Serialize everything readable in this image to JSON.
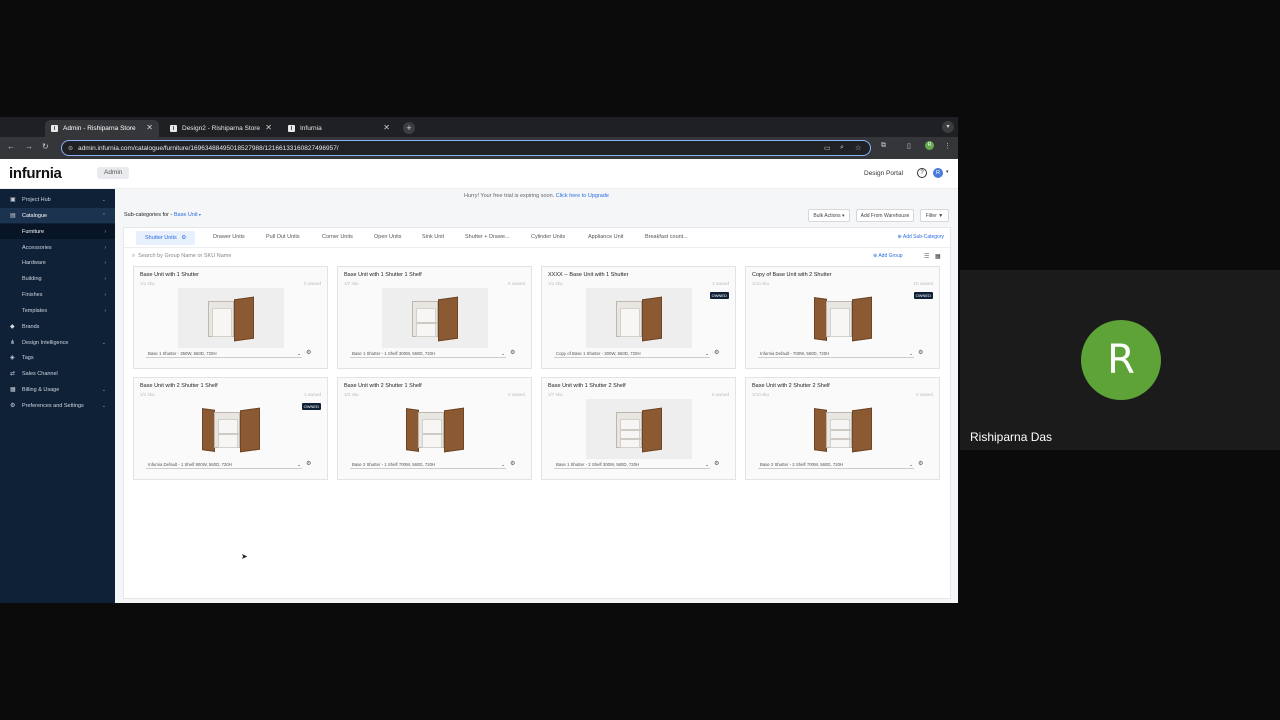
{
  "browser": {
    "tabs": [
      {
        "label": "Admin - Rishiparna Store",
        "active": true
      },
      {
        "label": "Design2 - Rishiparna Store",
        "active": false
      },
      {
        "label": "Infurnia",
        "active": false
      }
    ],
    "url": "admin.infurnia.com/catalogue/furniture/16963488495018527988/12166133160827496957/"
  },
  "app": {
    "logo": "infurnia",
    "badge": "Admin",
    "design_portal": "Design Portal",
    "user_initial": "R",
    "trial_text": "Hurry! Your free trial is expiring soon.",
    "trial_link": "Click here to Upgrade"
  },
  "sidebar": {
    "items": [
      {
        "label": "Project Hub"
      },
      {
        "label": "Catalogue"
      },
      {
        "label": "Furniture"
      },
      {
        "label": "Accessories"
      },
      {
        "label": "Hardware"
      },
      {
        "label": "Building"
      },
      {
        "label": "Finishes"
      },
      {
        "label": "Templates"
      },
      {
        "label": "Brands"
      },
      {
        "label": "Design Intelligence"
      },
      {
        "label": "Tags"
      },
      {
        "label": "Sales Channel"
      },
      {
        "label": "Billing & Usage"
      },
      {
        "label": "Preferences and Settings"
      }
    ]
  },
  "toolbar": {
    "subcat_prefix": "Sub-categories for -",
    "subcat_value": "Base Unit",
    "bulk_actions": "Bulk Actions",
    "add_from_warehouse": "Add From Warehouse",
    "filter": "Filter"
  },
  "subtabs": {
    "items": [
      "Shutter Units",
      "Drawer Units",
      "Pull Out Units",
      "Corner Units",
      "Open Units",
      "Sink Unit",
      "Shutter + Drawe...",
      "Cylinder Units",
      "Appliance Unit",
      "Breakfast count..."
    ],
    "add_subcategory": "Add Sub-Category"
  },
  "search": {
    "placeholder": "Search by Group Name or SKU Name"
  },
  "add_group": "Add Group",
  "products": [
    {
      "title": "Base Unit with 1 Shutter",
      "skus": "1/1 sku",
      "owned": "0 owned",
      "tag": "",
      "option": "Base 1 Shutter - 350W, 560D, 720H"
    },
    {
      "title": "Base Unit with 1 Shutter 1 Shelf",
      "skus": "1/7 sku",
      "owned": "0 owned",
      "tag": "",
      "option": "Base 1 Shutter - 1 Shelf 300W, 560D, 720H"
    },
    {
      "title": "XXXX -- Base Unit with 1 Shutter",
      "skus": "1/1 sku",
      "owned": "1 owned",
      "tag": "OWNED",
      "option": "Copy of Base 1 Shutter - 300W, 560D, 720H"
    },
    {
      "title": "Copy of Base Unit with 2 Shutter",
      "skus": "1/10 sku",
      "owned": "10 owned",
      "tag": "OWNED",
      "option": "Infurnia Default - 700W, 560D, 720H"
    },
    {
      "title": "Base Unit with 2 Shutter 1 Shelf",
      "skus": "1/1 sku",
      "owned": "1 owned",
      "tag": "OWNED",
      "option": "Infurnia Default - 1 Shelf 900W, 560D, 720H"
    },
    {
      "title": "Base Unit with 2 Shutter 1 Shelf",
      "skus": "1/3 sku",
      "owned": "0 owned",
      "tag": "",
      "option": "Base 2 Shutter - 1 Shelf 700W, 560D, 720H"
    },
    {
      "title": "Base Unit with 1 Shutter 2 Shelf",
      "skus": "1/7 sku",
      "owned": "0 owned",
      "tag": "",
      "option": "Base 1 Shutter - 2 Shelf 300W, 560D, 720H"
    },
    {
      "title": "Base Unit with 2 Shutter 2 Shelf",
      "skus": "1/10 sku",
      "owned": "0 owned",
      "tag": "",
      "option": "Base 2 Shutter - 2 Shelf 700W, 560D, 720H"
    }
  ],
  "participant": {
    "initial": "R",
    "name": "Rishiparna Das"
  }
}
